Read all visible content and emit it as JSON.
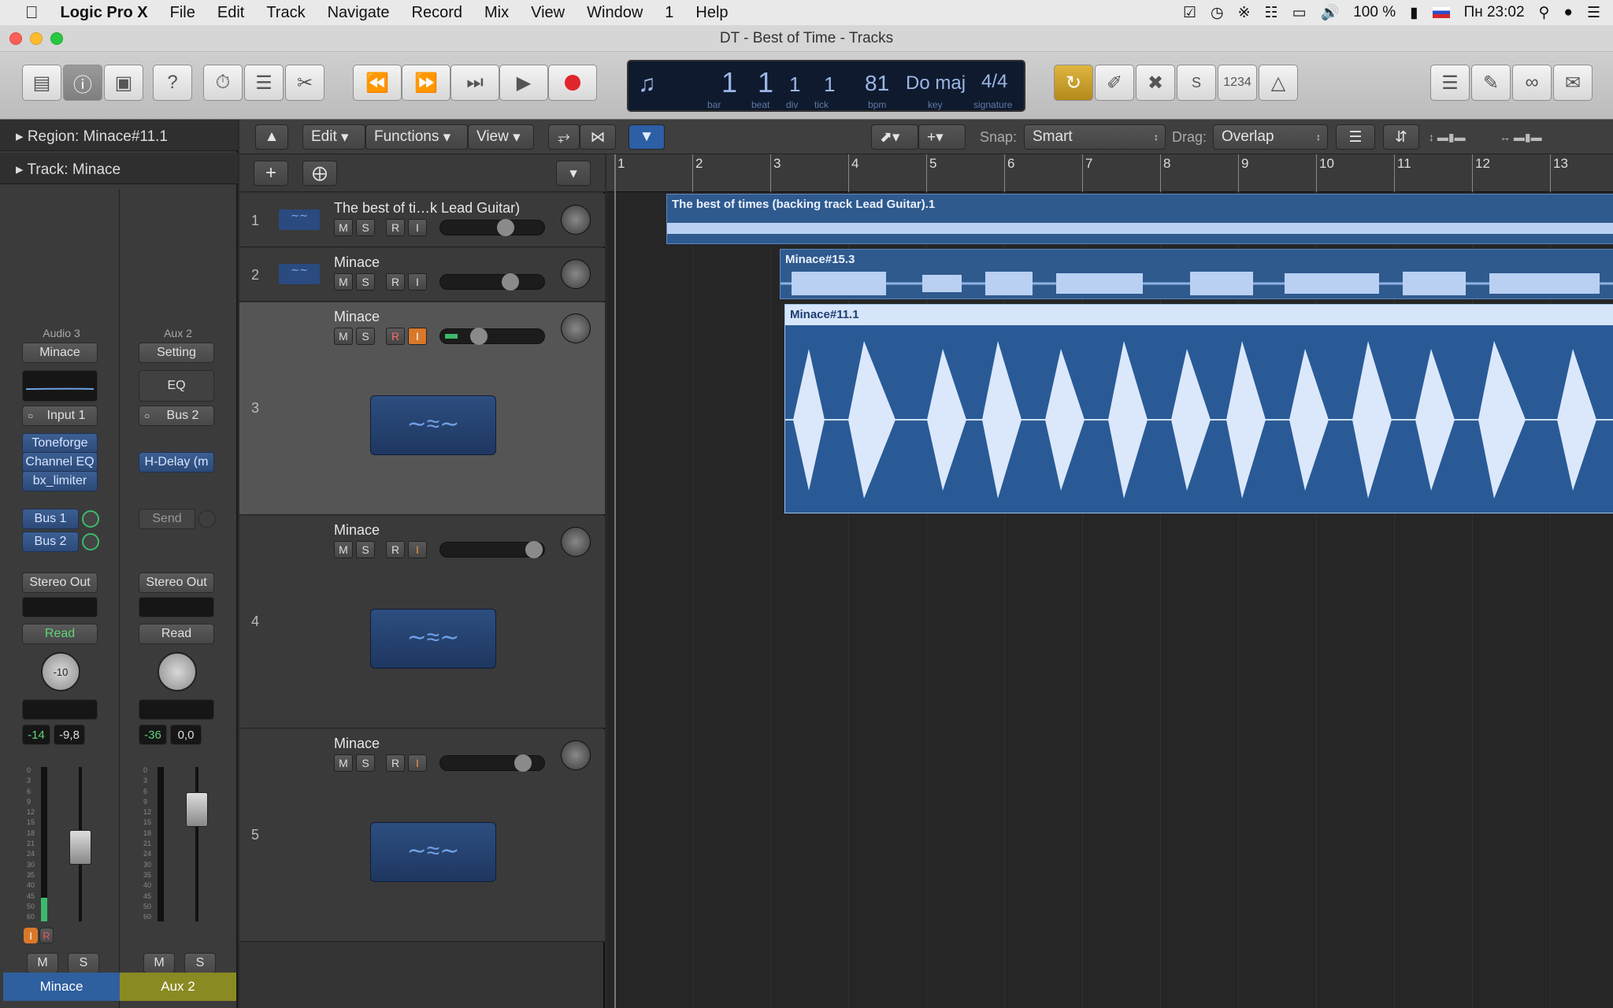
{
  "menubar": {
    "app": "Logic Pro X",
    "items": [
      "File",
      "Edit",
      "Track",
      "Navigate",
      "Record",
      "Mix",
      "View",
      "Window",
      "1",
      "Help"
    ],
    "battery": "100 %",
    "clock": "Пн 23:02"
  },
  "window": {
    "title": "DT - Best of Time - Tracks"
  },
  "lcd": {
    "bar": "1",
    "beat": "1",
    "div": "1",
    "tick": "1",
    "bpm": "81",
    "key": "Do maj",
    "signature": "4/4",
    "labels": {
      "bar": "bar",
      "beat": "beat",
      "div": "div",
      "tick": "tick",
      "bpm": "bpm",
      "key": "key",
      "signature": "signature"
    }
  },
  "toolbar": {
    "counter": "1234"
  },
  "inspector": {
    "region": "Region: Minace#11.1",
    "track": "Track:  Minace",
    "strip1": {
      "type": "Audio 3",
      "setting": "Minace",
      "input": "Input 1",
      "plugins": [
        "Toneforge",
        "Channel EQ",
        "bx_limiter"
      ],
      "sends": [
        "Bus 1",
        "Bus 2"
      ],
      "output": "Stereo Out",
      "automation": "Read",
      "pan": "-10",
      "level1": "-14",
      "level2": "-9,8",
      "scale": [
        "0",
        "3",
        "6",
        "9",
        "12",
        "15",
        "18",
        "21",
        "24",
        "30",
        "35",
        "40",
        "45",
        "50",
        "60"
      ],
      "i": "I",
      "r": "R",
      "m": "M",
      "s": "S",
      "name": "Minace"
    },
    "strip2": {
      "type": "Aux 2",
      "setting": "Setting",
      "eq": "EQ",
      "input": "Bus 2",
      "plugins": [
        "H-Delay (m"
      ],
      "send": "Send",
      "output": "Stereo Out",
      "automation": "Read",
      "level1": "-36",
      "level2": "0,0",
      "scale": [
        "0",
        "3",
        "6",
        "9",
        "12",
        "15",
        "18",
        "21",
        "24",
        "30",
        "35",
        "40",
        "45",
        "50",
        "60"
      ],
      "m": "M",
      "s": "S",
      "name": "Aux 2"
    }
  },
  "tracksheader": {
    "edit": "Edit",
    "functions": "Functions",
    "view": "View",
    "snap_label": "Snap:",
    "snap": "Smart",
    "drag_label": "Drag:",
    "drag": "Overlap"
  },
  "tracks": [
    {
      "num": "1",
      "name": "The best of ti…k Lead Guitar)"
    },
    {
      "num": "2",
      "name": "Minace"
    },
    {
      "num": "3",
      "name": "Minace"
    },
    {
      "num": "4",
      "name": "Minace"
    },
    {
      "num": "5",
      "name": "Minace"
    }
  ],
  "trackbuttons": {
    "m": "M",
    "s": "S",
    "r": "R",
    "i": "I"
  },
  "ruler": [
    "1",
    "2",
    "3",
    "4",
    "5",
    "6",
    "7",
    "8",
    "9",
    "10",
    "11",
    "12",
    "13"
  ],
  "regions": [
    {
      "name": "The best of times (backing track Lead Guitar).1"
    },
    {
      "name": "Minace#15.3"
    },
    {
      "name": "Minace#11.1"
    }
  ]
}
